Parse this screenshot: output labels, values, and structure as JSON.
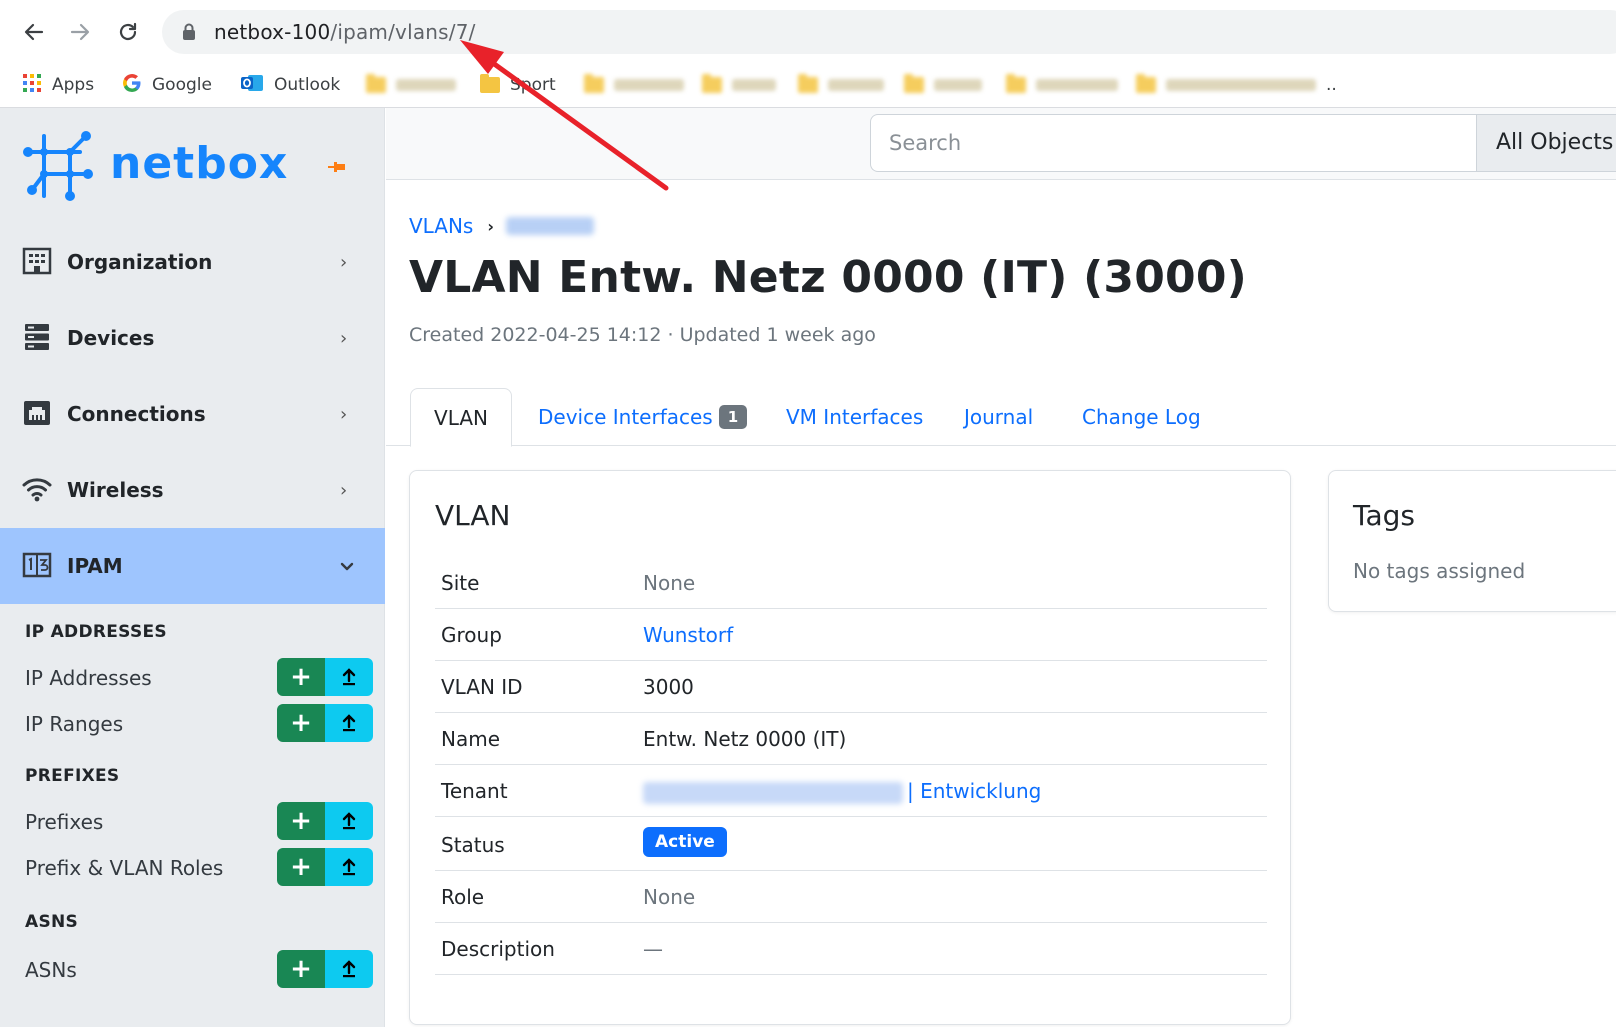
{
  "browser": {
    "url_host": "netbox-100",
    "url_path": "/ipam/vlans/7/",
    "bookmarks": [
      {
        "label": "Apps",
        "icon": "apps-grid-icon"
      },
      {
        "label": "Google",
        "icon": "google-icon"
      },
      {
        "label": "Outlook",
        "icon": "outlook-icon"
      },
      {
        "label": "Sport",
        "icon": "folder-icon"
      }
    ],
    "bookmarks_overflow": ".."
  },
  "sidebar": {
    "brand": "netbox",
    "menu": [
      {
        "label": "Organization",
        "icon": "building-icon"
      },
      {
        "label": "Devices",
        "icon": "server-icon"
      },
      {
        "label": "Connections",
        "icon": "ethernet-port-icon"
      },
      {
        "label": "Wireless",
        "icon": "wifi-icon"
      },
      {
        "label": "IPAM",
        "icon": "ipam-icon",
        "active": true
      }
    ],
    "sections": [
      {
        "title": "IP ADDRESSES",
        "items": [
          "IP Addresses",
          "IP Ranges"
        ]
      },
      {
        "title": "PREFIXES",
        "items": [
          "Prefixes",
          "Prefix & VLAN Roles"
        ]
      },
      {
        "title": "ASNS",
        "items": [
          "ASNs"
        ]
      }
    ]
  },
  "topbar": {
    "search_placeholder": "Search",
    "scope": "All Objects"
  },
  "breadcrumb": {
    "root": "VLANs"
  },
  "page": {
    "title": "VLAN Entw. Netz 0000 (IT) (3000)",
    "meta": "Created 2022-04-25 14:12 · Updated 1 week ago"
  },
  "tabs": [
    {
      "label": "VLAN",
      "active": true
    },
    {
      "label": "Device Interfaces",
      "badge": "1"
    },
    {
      "label": "VM Interfaces"
    },
    {
      "label": "Journal"
    },
    {
      "label": "Change Log"
    }
  ],
  "vlan_card": {
    "title": "VLAN",
    "rows": [
      {
        "key": "Site",
        "value": "None"
      },
      {
        "key": "Group",
        "value": "Wunstorf"
      },
      {
        "key": "VLAN ID",
        "value": "3000"
      },
      {
        "key": "Name",
        "value": "Entw. Netz 0000 (IT)"
      },
      {
        "key": "Tenant",
        "value": "| Entwicklung"
      },
      {
        "key": "Status",
        "value": "Active"
      },
      {
        "key": "Role",
        "value": "None"
      },
      {
        "key": "Description",
        "value": "—"
      }
    ]
  },
  "tags_card": {
    "title": "Tags",
    "empty_text": "No tags assigned"
  },
  "colors": {
    "brand": "#1685fc",
    "link": "#0d6efd",
    "sidebar_active": "#9ec5fe",
    "add_button": "#198754",
    "import_button": "#0dcaf0",
    "annotation_arrow": "#e8222a"
  }
}
